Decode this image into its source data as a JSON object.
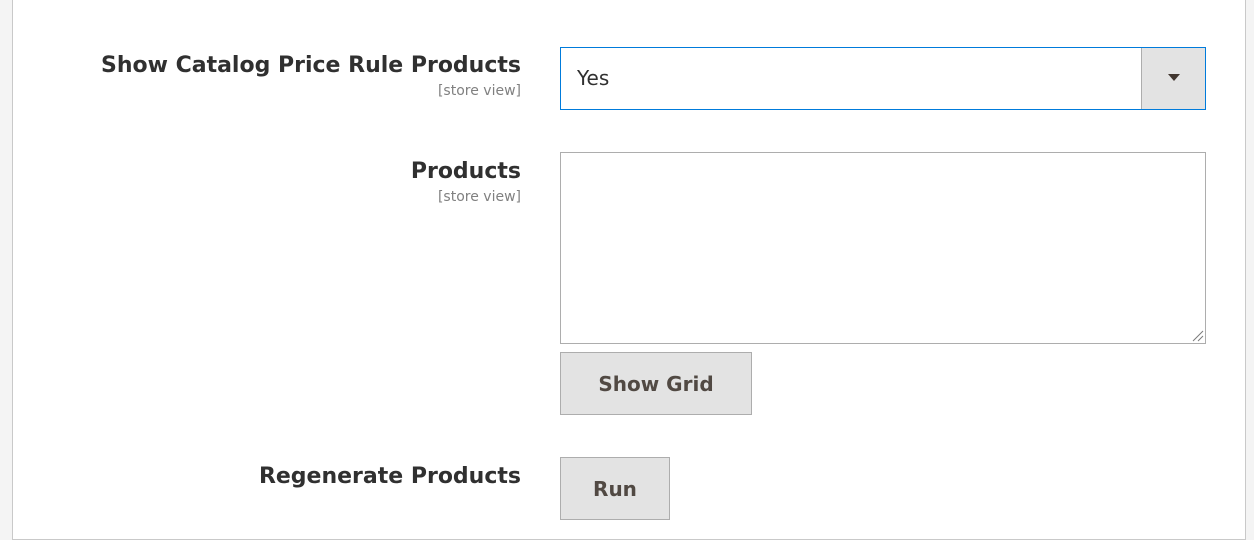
{
  "fields": {
    "catalog_rule": {
      "label": "Show Catalog Price Rule Products",
      "scope": "[store view]",
      "value": "Yes"
    },
    "products": {
      "label": "Products",
      "scope": "[store view]",
      "value": "",
      "show_grid_label": "Show Grid"
    },
    "regenerate": {
      "label": "Regenerate Products",
      "run_label": "Run"
    }
  },
  "colors": {
    "focus_border": "#007bdb",
    "button_bg": "#e3e3e3",
    "label_text": "#303030",
    "scope_text": "#808080"
  },
  "icons": {
    "select_arrow": "chevron-down-icon",
    "resize_handle": "resize-handle-icon"
  }
}
